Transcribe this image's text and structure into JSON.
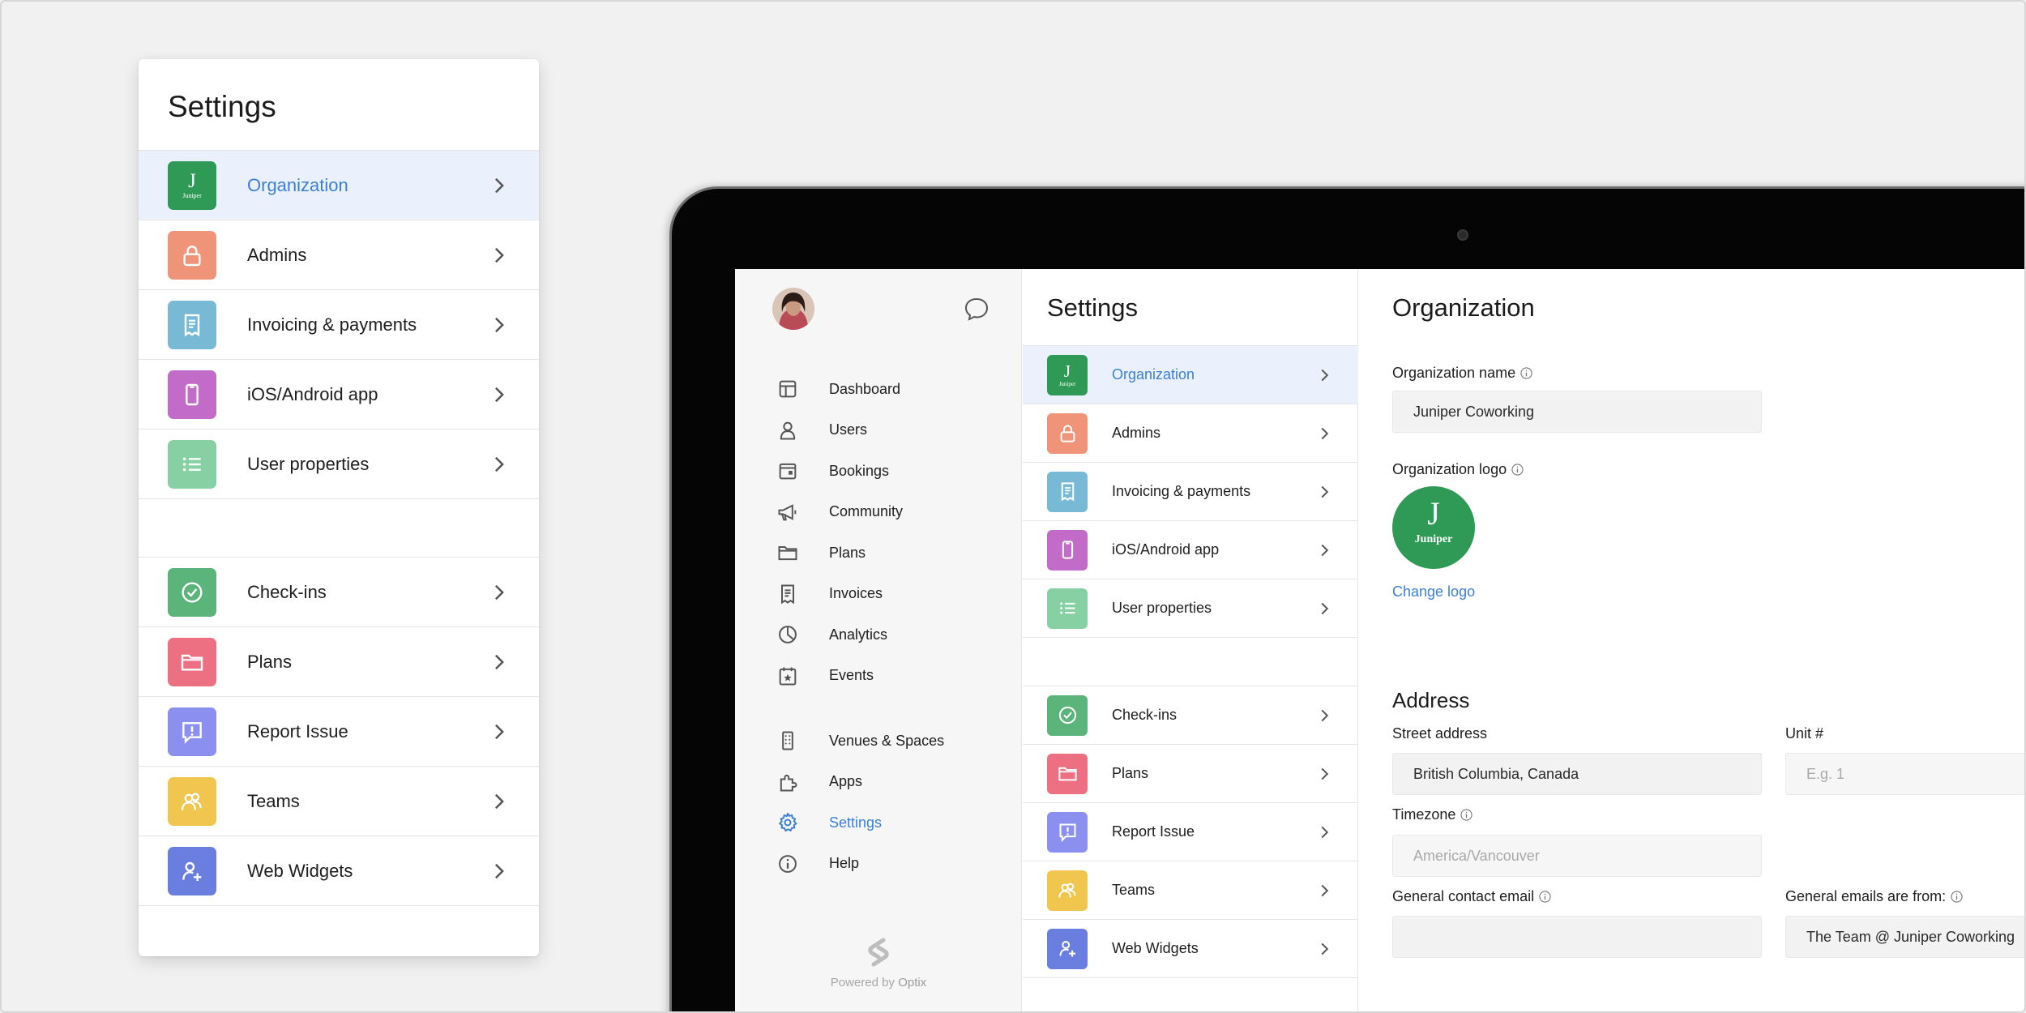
{
  "card": {
    "title": "Settings",
    "group1": [
      {
        "label": "Organization",
        "icon": "juniper-logo-icon",
        "color": "#2f9a55",
        "active": true
      },
      {
        "label": "Admins",
        "icon": "lock-icon",
        "color": "#ef9479"
      },
      {
        "label": "Invoicing & payments",
        "icon": "receipt-icon",
        "color": "#78b9d6"
      },
      {
        "label": "iOS/Android app",
        "icon": "phone-icon",
        "color": "#c36bc8"
      },
      {
        "label": "User properties",
        "icon": "list-icon",
        "color": "#86d0a3"
      }
    ],
    "group2": [
      {
        "label": "Check-ins",
        "icon": "check-circle-icon",
        "color": "#5bb47a"
      },
      {
        "label": "Plans",
        "icon": "folder-icon",
        "color": "#ec7082"
      },
      {
        "label": "Report Issue",
        "icon": "report-icon",
        "color": "#8b8ff0"
      },
      {
        "label": "Teams",
        "icon": "teams-icon",
        "color": "#f1c64e"
      },
      {
        "label": "Web Widgets",
        "icon": "add-user-icon",
        "color": "#6a7ee0"
      }
    ]
  },
  "juniper": {
    "letter": "J",
    "name": "Juniper"
  },
  "nav": {
    "items": [
      {
        "label": "Dashboard",
        "icon": "dashboard-icon"
      },
      {
        "label": "Users",
        "icon": "user-icon"
      },
      {
        "label": "Bookings",
        "icon": "bookings-icon"
      },
      {
        "label": "Community",
        "icon": "megaphone-icon"
      },
      {
        "label": "Plans",
        "icon": "folder-icon"
      },
      {
        "label": "Invoices",
        "icon": "invoice-icon"
      },
      {
        "label": "Analytics",
        "icon": "pie-chart-icon"
      },
      {
        "label": "Events",
        "icon": "calendar-star-icon"
      }
    ],
    "items2": [
      {
        "label": "Venues & Spaces",
        "icon": "building-icon"
      },
      {
        "label": "Apps",
        "icon": "puzzle-icon"
      },
      {
        "label": "Settings",
        "icon": "gear-icon",
        "active": true
      },
      {
        "label": "Help",
        "icon": "info-icon"
      }
    ],
    "powered_by": "Powered by",
    "powered_brand": "Optix"
  },
  "settings_col": {
    "title": "Settings"
  },
  "detail": {
    "title": "Organization",
    "org_name_label": "Organization name",
    "org_name_value": "Juniper Coworking",
    "org_logo_label": "Organization logo",
    "change_logo": "Change logo",
    "address_heading": "Address",
    "street_label": "Street address",
    "street_value": "British Columbia, Canada",
    "unit_label": "Unit #",
    "unit_placeholder": "E.g. 1",
    "timezone_label": "Timezone",
    "timezone_placeholder": "America/Vancouver",
    "contact_email_label": "General contact email",
    "contact_email_value": "",
    "emails_from_label": "General emails are from:",
    "emails_from_value": "The Team @ Juniper Coworking"
  }
}
